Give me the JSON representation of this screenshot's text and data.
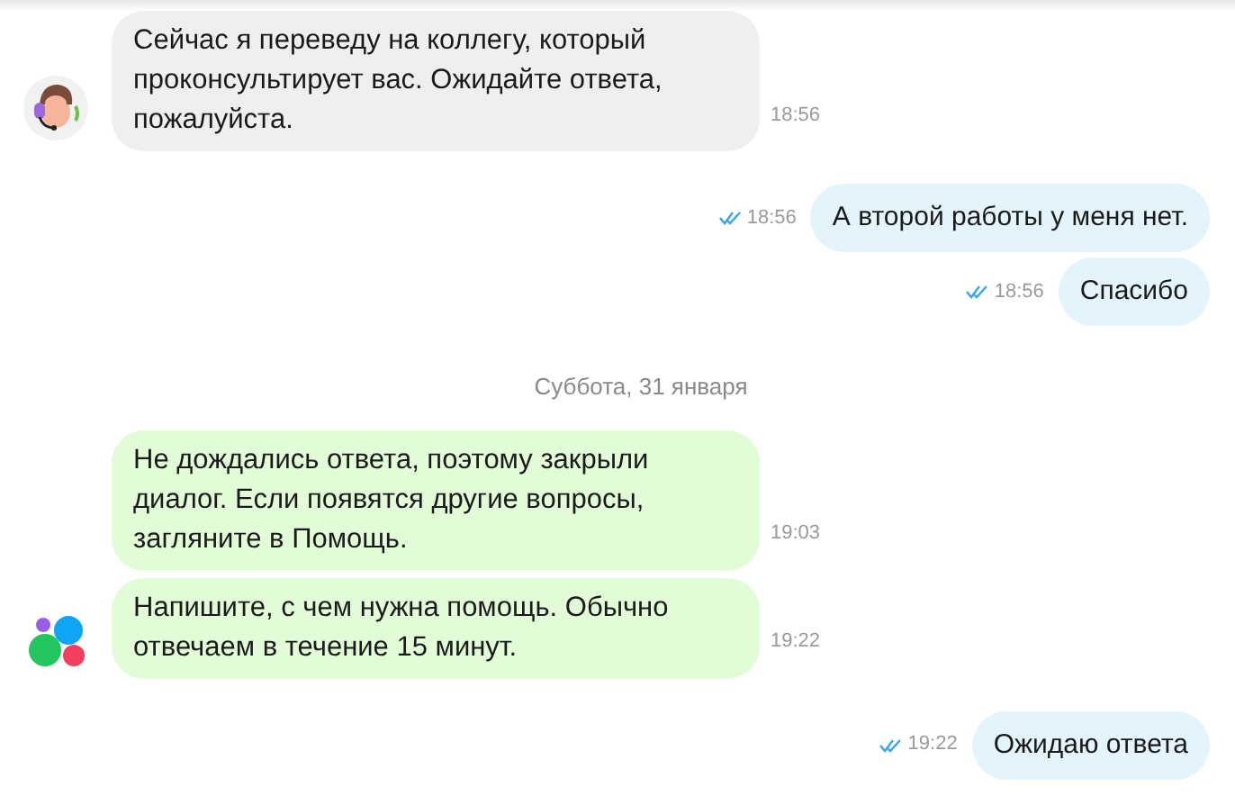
{
  "messages": [
    {
      "kind": "incoming",
      "text": "Сейчас я переведу на коллегу, который проконсультирует вас. Ожидайте ответа, пожалуйста.",
      "time": "18:56",
      "color": "#f0efee",
      "avatar": {
        "kind": "agent"
      }
    },
    {
      "kind": "outgoing",
      "text": "А второй работы у меня нет.",
      "time": "18:56",
      "read": true
    },
    {
      "kind": "outgoing",
      "text": "Спасибо",
      "time": "18:56",
      "read": true
    },
    {
      "kind": "date",
      "text": "Суббота, 31 января"
    },
    {
      "kind": "incoming",
      "text": "Не дождались ответа, поэтому закрыли диалог. Если появятся другие вопросы, загляните в Помощь.",
      "time": "19:03",
      "color": "#e2fcd8"
    },
    {
      "kind": "incoming",
      "text": "Напишите, с чем нужна помощь. Обычно отвечаем в течение 15 минут.",
      "time": "19:22",
      "color": "#e2fcd8",
      "avatar": {
        "kind": "brand"
      }
    },
    {
      "kind": "outgoing",
      "text": "Ожидаю ответа",
      "time": "19:22",
      "read": true
    }
  ]
}
